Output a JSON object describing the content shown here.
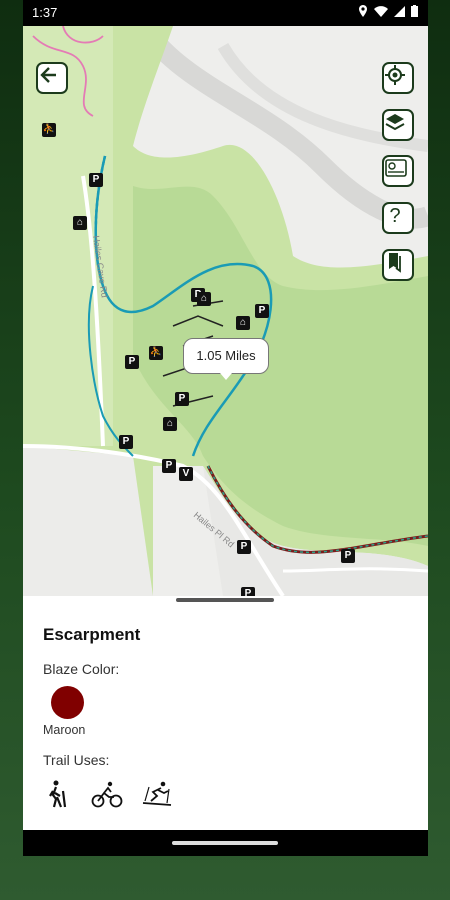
{
  "status_bar": {
    "time": "1:37"
  },
  "map": {
    "tooltip": "1.05 Miles",
    "road_labels": [
      "Hailes Cave Rd",
      "Hailes Pl Rd"
    ],
    "buttons": [
      "back",
      "my-location",
      "layers",
      "legend",
      "help",
      "bookmarks"
    ]
  },
  "sheet": {
    "title": "Escarpment",
    "blaze_label": "Blaze Color:",
    "blaze_color_name": "Maroon",
    "blaze_color": "#800000",
    "uses_label": "Trail Uses:",
    "uses": [
      "hiking-icon",
      "biking-icon",
      "skiing-icon"
    ]
  }
}
